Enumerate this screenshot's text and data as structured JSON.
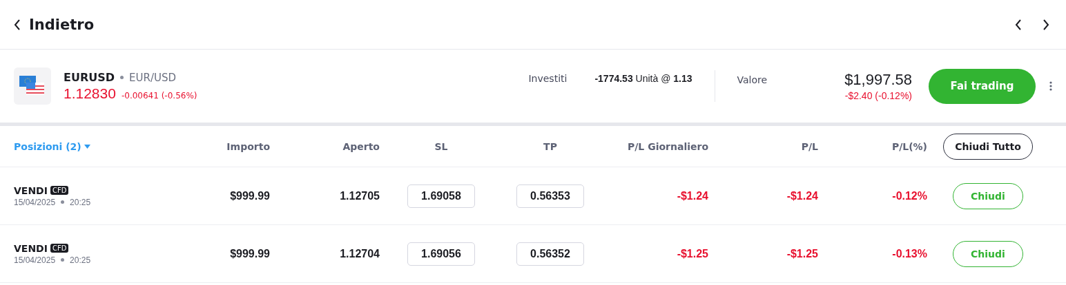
{
  "header": {
    "back_label": "Indietro"
  },
  "instrument": {
    "symbol": "EURUSD",
    "pair": "EUR/USD",
    "price": "1.12830",
    "change": "-0.00641 (-0.56%)",
    "invested_label": "Investiti",
    "invested_value": "**-1774.53** Unità @ **1.13**",
    "value_label": "Valore",
    "value": "$1,997.58",
    "value_change": "-$2.40 (-0.12%)",
    "trade_button": "Fai trading"
  },
  "table": {
    "positions_tab": "Posizioni (2)",
    "columns": [
      "Importo",
      "Aperto",
      "SL",
      "TP",
      "P/L Giornaliero",
      "P/L",
      "P/L(%)"
    ],
    "close_all": "Chiudi Tutto",
    "rows": [
      {
        "side": "VENDI",
        "badge": "CFD",
        "date": "15/04/2025",
        "time": "20:25",
        "amount": "$999.99",
        "open": "1.12705",
        "sl": "1.69058",
        "tp": "0.56353",
        "pl_daily": "-$1.24",
        "pl": "-$1.24",
        "pl_pct": "-0.12%",
        "close": "Chiudi"
      },
      {
        "side": "VENDI",
        "badge": "CFD",
        "date": "15/04/2025",
        "time": "20:25",
        "amount": "$999.99",
        "open": "1.12704",
        "sl": "1.69056",
        "tp": "0.56352",
        "pl_daily": "-$1.25",
        "pl": "-$1.25",
        "pl_pct": "-0.13%",
        "close": "Chiudi"
      }
    ]
  }
}
